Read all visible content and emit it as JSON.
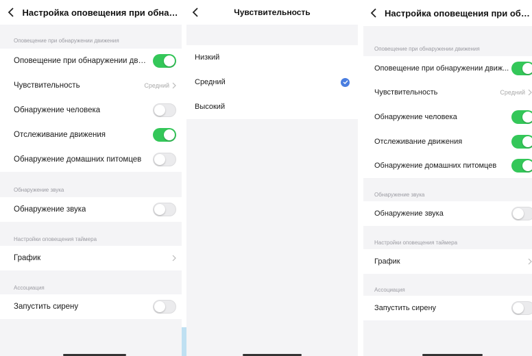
{
  "colors": {
    "toggle_on": "#34c759",
    "toggle_off": "#ebebed",
    "check": "#4a7ee0",
    "background": "#f4f4f6"
  },
  "panel1": {
    "title": "Настройка оповещения при обнаруж...",
    "sections": {
      "motion": "Оповещение при обнаружении движения",
      "sound": "Обнаружение звука",
      "timer": "Настройки оповещения таймера",
      "assoc": "Ассоциация"
    },
    "rows": {
      "motion_alert": {
        "label": "Оповещение при обнаружении движ...",
        "toggle": "on"
      },
      "sensitivity": {
        "label": "Чувствительность",
        "value": "Средний"
      },
      "human": {
        "label": "Обнаружение человека",
        "toggle": "off"
      },
      "tracking": {
        "label": "Отслеживание движения",
        "toggle": "on"
      },
      "pets": {
        "label": "Обнаружение домашних питомцев",
        "toggle": "off"
      },
      "sound": {
        "label": "Обнаружение звука",
        "toggle": "off"
      },
      "schedule": {
        "label": "График"
      },
      "siren": {
        "label": "Запустить сирену",
        "toggle": "off"
      }
    }
  },
  "panel2": {
    "title": "Чувствительность",
    "options": [
      "Низкий",
      "Средний",
      "Высокий"
    ],
    "selected": "Средний"
  },
  "panel3": {
    "title": "Настройка оповещения при обнаруж...",
    "sections": {
      "motion": "Оповещение при обнаружении движения",
      "sound": "Обнаружение звука",
      "timer": "Настройки оповещения таймера",
      "assoc": "Ассоциация"
    },
    "rows": {
      "motion_alert": {
        "label": "Оповещение при обнаружении движ...",
        "toggle": "on"
      },
      "sensitivity": {
        "label": "Чувствительность",
        "value": "Средний"
      },
      "human": {
        "label": "Обнаружение человека",
        "toggle": "on"
      },
      "tracking": {
        "label": "Отслеживание движения",
        "toggle": "on"
      },
      "pets": {
        "label": "Обнаружение домашних питомцев",
        "toggle": "on"
      },
      "sound": {
        "label": "Обнаружение звука",
        "toggle": "off"
      },
      "schedule": {
        "label": "График"
      },
      "siren": {
        "label": "Запустить сирену",
        "toggle": "off"
      }
    }
  }
}
